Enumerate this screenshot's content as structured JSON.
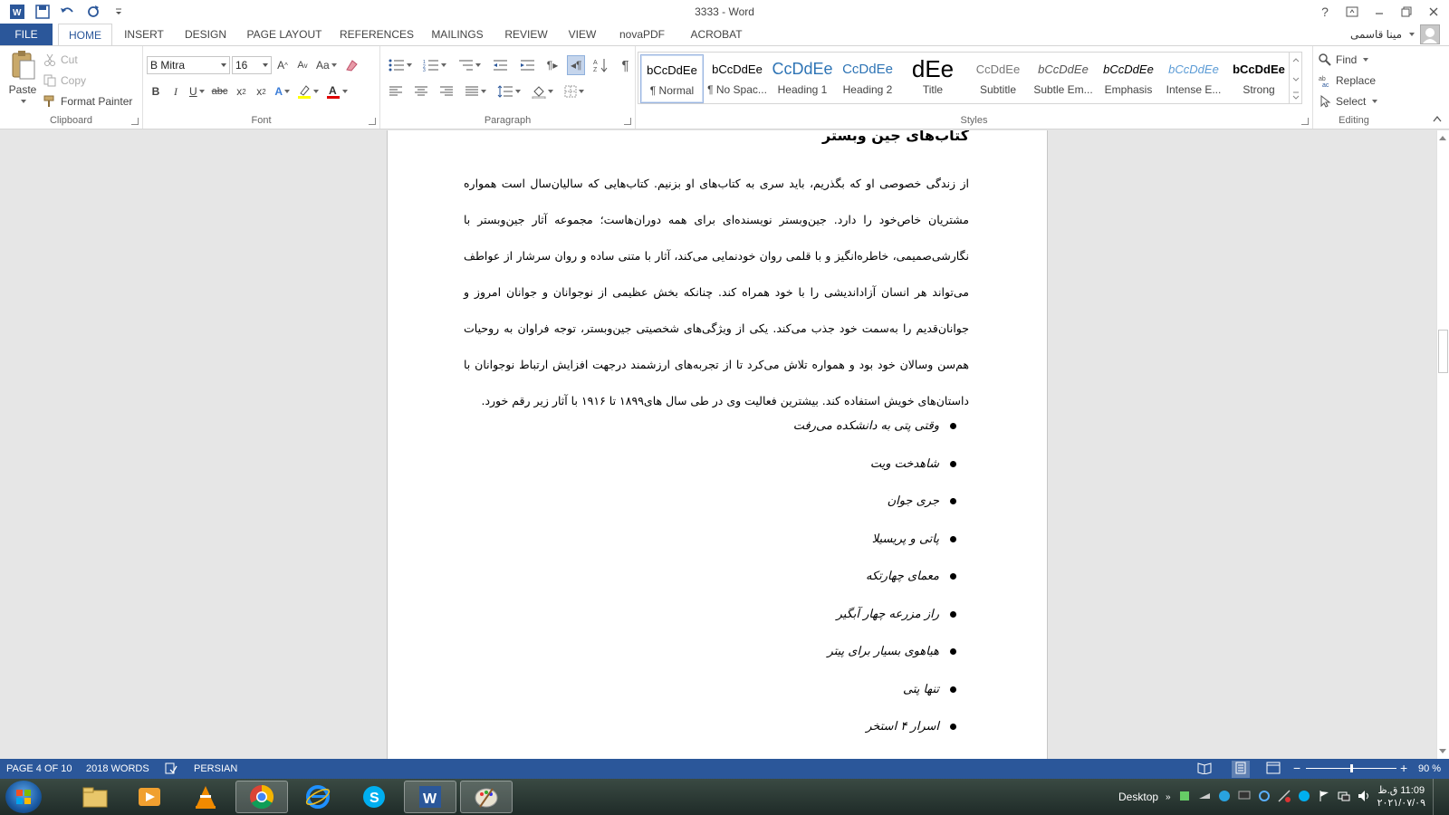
{
  "window": {
    "title": "3333 - Word",
    "help": "?",
    "user_name": "مینا قاسمی"
  },
  "tabs": {
    "file": "FILE",
    "items": [
      "HOME",
      "INSERT",
      "DESIGN",
      "PAGE LAYOUT",
      "REFERENCES",
      "MAILINGS",
      "REVIEW",
      "VIEW",
      "novaPDF",
      "ACROBAT"
    ],
    "active": "HOME"
  },
  "ribbon": {
    "clipboard": {
      "label": "Clipboard",
      "paste": "Paste",
      "cut": "Cut",
      "copy": "Copy",
      "format_painter": "Format Painter"
    },
    "font": {
      "label": "Font",
      "font_name": "B Mitra",
      "font_size": "16",
      "change_case": "Aa"
    },
    "paragraph": {
      "label": "Paragraph"
    },
    "styles": {
      "label": "Styles",
      "items": [
        {
          "preview": "bCcDdEe",
          "name": "¶ Normal"
        },
        {
          "preview": "bCcDdEe",
          "name": "¶ No Spac..."
        },
        {
          "preview": "CcDdEe",
          "name": "Heading 1"
        },
        {
          "preview": "CcDdEe",
          "name": "Heading 2"
        },
        {
          "preview": "dEe",
          "name": "Title"
        },
        {
          "preview": "CcDdEe",
          "name": "Subtitle"
        },
        {
          "preview": "bCcDdEe",
          "name": "Subtle Em..."
        },
        {
          "preview": "bCcDdEe",
          "name": "Emphasis"
        },
        {
          "preview": "bCcDdEe",
          "name": "Intense E..."
        },
        {
          "preview": "bCcDdEe",
          "name": "Strong"
        }
      ]
    },
    "editing": {
      "label": "Editing",
      "find": "Find",
      "replace": "Replace",
      "select": "Select"
    }
  },
  "document": {
    "heading": "کتاب‌های جین وبستر",
    "paragraph": "از زندگی خصوصی او که بگذریم، باید سری به کتاب‌های او بزنیم. کتاب‌هایی که سالیان‌سال است همواره مشتریان خاص‌خود را دارد. جین‌وبستر نویسنده‌ای برای همه دوران‌هاست؛ مجموعه آثار جین‌وبستر با نگارشی‌صمیمی، خاطره‌انگیز و با قلمی روان خودنمایی می‌کند، آثار با متنی ساده و روان سرشار از عواطف می‌تواند هر انسان آزاداندیشی را با خود همراه کند. چنانکه بخش عظیمی از نوجوانان و جوانان امروز و جوانان‌قدیم را به‌سمت خود جذب می‌کند. یکی از ویژگی‌های شخصیتی جین‌وبستر، توجه فراوان به روحیات هم‌سن وسالان خود بود و همواره تلاش می‌کرد تا از تجربه‌های ارزشمند درجهت افزایش ارتباط نوجوانان با داستان‌های خویش استفاده کند. بیشترین فعالیت وی در طی سال های۱۸۹۹ تا ۱۹۱۶ با آثار زیر رقم خورد.",
    "bullets": [
      "وقتی پتی به دانشکده می‌رفت",
      "شاهدخت ویت",
      "جری جوان",
      "پاتی و پریسیلا",
      "معمای چهارتکه",
      "راز مزرعه چهار آبگیر",
      "هیاهوی بسیار برای پیتر",
      "تنها پتی",
      "اسرار ۴ استخر"
    ]
  },
  "statusbar": {
    "page": "PAGE 4 OF 10",
    "words": "2018 WORDS",
    "language": "PERSIAN",
    "zoom": "90 %",
    "zoom_level": 0.5
  },
  "taskbar": {
    "desktop": "Desktop",
    "time": "11:09 ق.ظ",
    "date": "۲۰۲۱/۰۷/۰۹"
  },
  "colors": {
    "accent": "#2b579a",
    "statusbar": "#2b579a"
  }
}
